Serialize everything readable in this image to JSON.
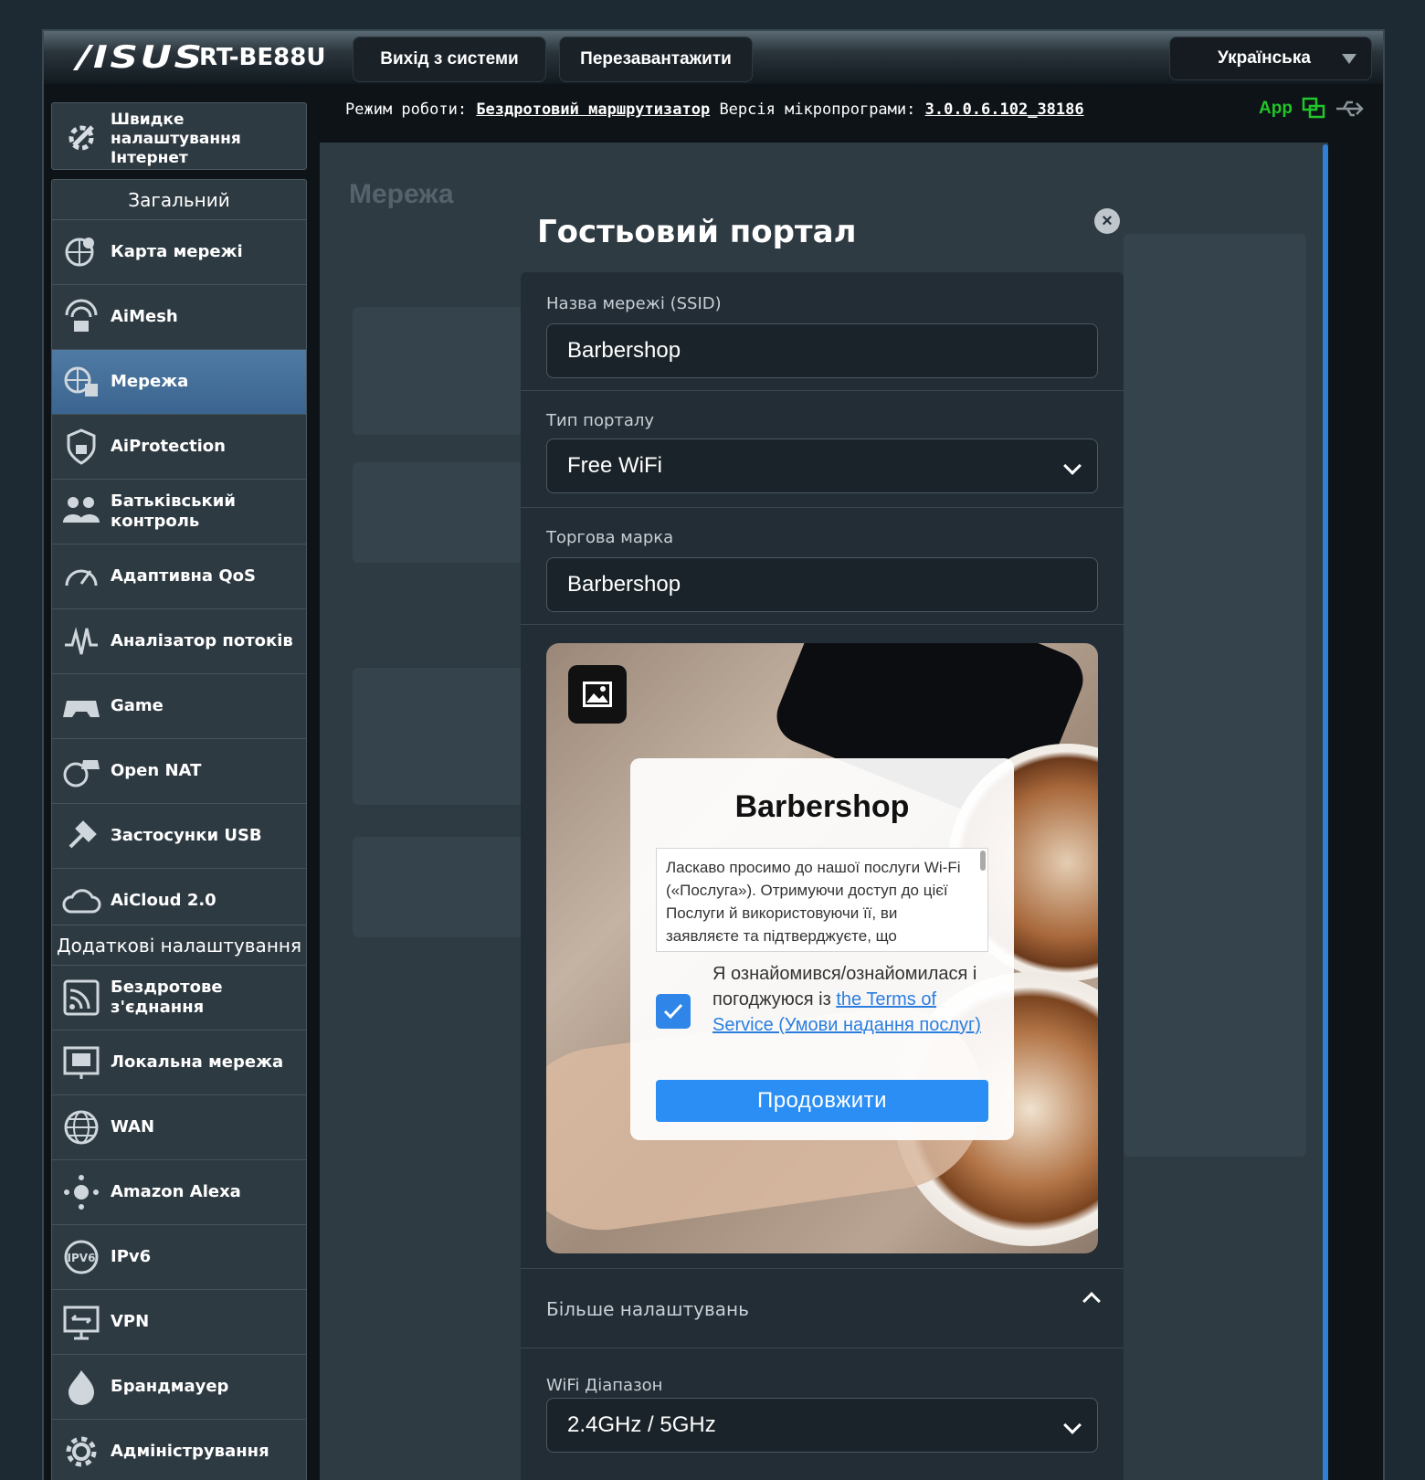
{
  "header": {
    "brand": "/ISUS",
    "model": "RT-BE88U",
    "logout_label": "Вихід з системи",
    "reboot_label": "Перезавантажити",
    "language": "Українська"
  },
  "status": {
    "mode_label": "Режим роботи:",
    "mode_value": "Бездротовий маршрутизатор",
    "firmware_label": "Версія мікропрограми:",
    "firmware_value": "3.0.0.6.102_38186",
    "app_label": "App"
  },
  "sidebar": {
    "quick_setup": "Швидке налаштування Інтернет",
    "general_title": "Загальний",
    "general_items": [
      {
        "label": "Карта мережі",
        "icon": "network-map-icon"
      },
      {
        "label": "AiMesh",
        "icon": "aimesh-icon"
      },
      {
        "label": "Мережа",
        "icon": "network-icon"
      },
      {
        "label": "AiProtection",
        "icon": "shield-icon"
      },
      {
        "label": "Батьківський контроль",
        "icon": "parental-icon"
      },
      {
        "label": "Адаптивна QoS",
        "icon": "gauge-icon"
      },
      {
        "label": "Аналізатор потоків",
        "icon": "traffic-icon"
      },
      {
        "label": "Game",
        "icon": "gamepad-icon"
      },
      {
        "label": "Open NAT",
        "icon": "open-nat-icon"
      },
      {
        "label": "Застосунки USB",
        "icon": "usb-icon"
      },
      {
        "label": "AiCloud 2.0",
        "icon": "cloud-icon"
      }
    ],
    "advanced_title": "Додаткові налаштування",
    "advanced_items": [
      {
        "label": "Бездротове з'єднання",
        "icon": "wireless-icon"
      },
      {
        "label": "Локальна мережа",
        "icon": "lan-icon"
      },
      {
        "label": "WAN",
        "icon": "globe-icon"
      },
      {
        "label": "Amazon Alexa",
        "icon": "alexa-icon"
      },
      {
        "label": "IPv6",
        "icon": "ipv6-icon"
      },
      {
        "label": "VPN",
        "icon": "vpn-icon"
      },
      {
        "label": "Брандмауер",
        "icon": "firewall-icon"
      },
      {
        "label": "Адміністрування",
        "icon": "gear-icon"
      }
    ]
  },
  "content": {
    "title": "Мережа"
  },
  "modal": {
    "title": "Гостьовий портал",
    "ssid_label": "Назва мережі (SSID)",
    "ssid_value": "Barbershop",
    "portal_type_label": "Тип порталу",
    "portal_type_value": "Free WiFi",
    "brand_label": "Торгова марка",
    "brand_value": "Barbershop",
    "preview": {
      "brand": "Barbershop",
      "terms_text": "Ласкаво просимо до нашої послуги Wi-Fi («Послуга»). Отримуючи доступ до цієї Послуги й використовуючи її, ви заявляєте та підтверджуєте, що",
      "agree_text": "Я ознайомився/ознайомилася і погоджуюся із",
      "agree_link": "the Terms of Service (Умови надання послуг)",
      "continue_label": "Продовжити",
      "checked": true
    },
    "more_settings_label": "Більше налаштувань",
    "wifi_band_label": "WiFi Діапазон",
    "wifi_band_value": "2.4GHz / 5GHz"
  },
  "colors": {
    "accent": "#2a8ef5",
    "active_item": "#4a7299",
    "app_green": "#22c52a"
  }
}
